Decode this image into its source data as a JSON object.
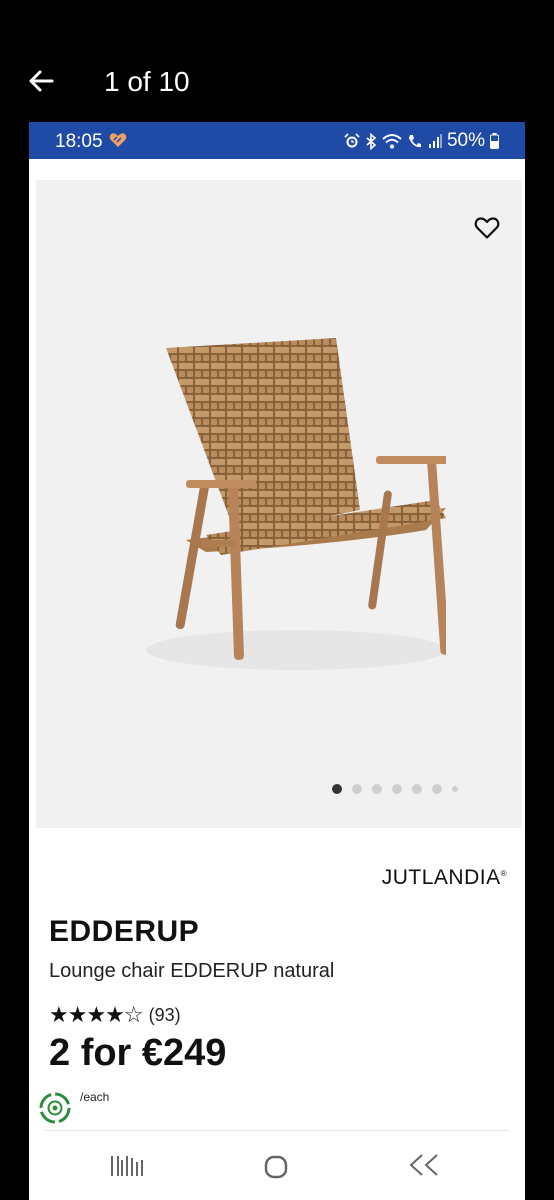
{
  "viewer": {
    "counter": "1 of 10",
    "back_icon": "arrow-left-icon"
  },
  "status_bar": {
    "time": "18:05",
    "battery": "50%",
    "icons": [
      "alarm-icon",
      "bluetooth-icon",
      "wifi-icon",
      "wifi-calling-icon",
      "signal-icon",
      "battery-icon"
    ],
    "color": "#1f4aa6"
  },
  "gallery": {
    "active_index": 0,
    "dot_count": 7,
    "wishlist_icon": "heart-outline-icon",
    "background": "#f1f1f1"
  },
  "product": {
    "brand": "JUTLANDIA",
    "brand_mark": "®",
    "name": "EDDERUP",
    "description": "Lounge chair EDDERUP natural",
    "stars_display": "★★★★☆",
    "rating_out_of_5": 4,
    "review_count": "(93)",
    "price": "2 for €249",
    "unit": "/each"
  },
  "nav_bar": {
    "recent_icon": "recent-apps-icon",
    "home_icon": "home-icon",
    "back_icon": "back-icon"
  }
}
